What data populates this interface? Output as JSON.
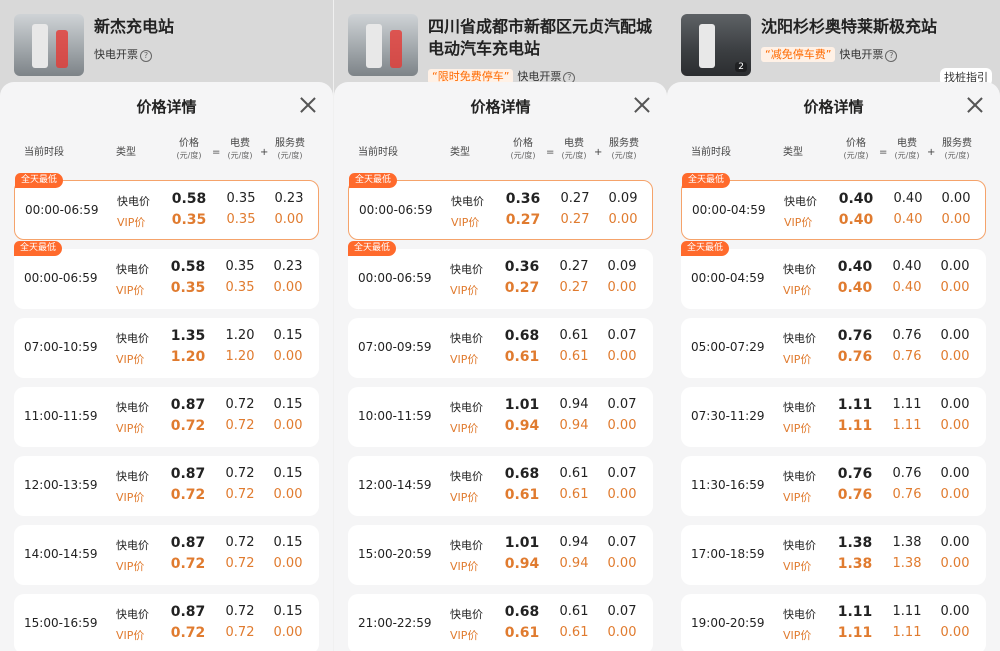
{
  "panels": [
    {
      "station_name": "新杰充电站",
      "promo_tag": "",
      "invoice": "快电开票",
      "guide": "",
      "photo_count": "",
      "title": "价格详情",
      "headers": {
        "time": "当前时段",
        "type": "类型",
        "price": "价格",
        "elec": "电费",
        "svc": "服务费",
        "unit": "(元/度)",
        "eq": "=",
        "plus": "+"
      },
      "rows": [
        {
          "badge": "全天最低",
          "time": "00:00-06:59",
          "fast": "快电价",
          "vip": "VIP价",
          "p": "0.58",
          "vp": "0.35",
          "e": "0.35",
          "ve": "0.35",
          "s": "0.23",
          "vs": "0.00"
        },
        {
          "badge": "全天最低",
          "time": "00:00-06:59",
          "fast": "快电价",
          "vip": "VIP价",
          "p": "0.58",
          "vp": "0.35",
          "e": "0.35",
          "ve": "0.35",
          "s": "0.23",
          "vs": "0.00"
        },
        {
          "badge": "",
          "time": "07:00-10:59",
          "fast": "快电价",
          "vip": "VIP价",
          "p": "1.35",
          "vp": "1.20",
          "e": "1.20",
          "ve": "1.20",
          "s": "0.15",
          "vs": "0.00"
        },
        {
          "badge": "",
          "time": "11:00-11:59",
          "fast": "快电价",
          "vip": "VIP价",
          "p": "0.87",
          "vp": "0.72",
          "e": "0.72",
          "ve": "0.72",
          "s": "0.15",
          "vs": "0.00"
        },
        {
          "badge": "",
          "time": "12:00-13:59",
          "fast": "快电价",
          "vip": "VIP价",
          "p": "0.87",
          "vp": "0.72",
          "e": "0.72",
          "ve": "0.72",
          "s": "0.15",
          "vs": "0.00"
        },
        {
          "badge": "",
          "time": "14:00-14:59",
          "fast": "快电价",
          "vip": "VIP价",
          "p": "0.87",
          "vp": "0.72",
          "e": "0.72",
          "ve": "0.72",
          "s": "0.15",
          "vs": "0.00"
        },
        {
          "badge": "",
          "time": "15:00-16:59",
          "fast": "快电价",
          "vip": "VIP价",
          "p": "0.87",
          "vp": "0.72",
          "e": "0.72",
          "ve": "0.72",
          "s": "0.15",
          "vs": "0.00"
        }
      ]
    },
    {
      "station_name": "四川省成都市新都区元贞汽配城电动汽车充电站",
      "promo_tag": "“限时免费停车”",
      "invoice": "快电开票",
      "guide": "",
      "photo_count": "",
      "title": "价格详情",
      "headers": {
        "time": "当前时段",
        "type": "类型",
        "price": "价格",
        "elec": "电费",
        "svc": "服务费",
        "unit": "(元/度)",
        "eq": "=",
        "plus": "+"
      },
      "rows": [
        {
          "badge": "全天最低",
          "time": "00:00-06:59",
          "fast": "快电价",
          "vip": "VIP价",
          "p": "0.36",
          "vp": "0.27",
          "e": "0.27",
          "ve": "0.27",
          "s": "0.09",
          "vs": "0.00"
        },
        {
          "badge": "全天最低",
          "time": "00:00-06:59",
          "fast": "快电价",
          "vip": "VIP价",
          "p": "0.36",
          "vp": "0.27",
          "e": "0.27",
          "ve": "0.27",
          "s": "0.09",
          "vs": "0.00"
        },
        {
          "badge": "",
          "time": "07:00-09:59",
          "fast": "快电价",
          "vip": "VIP价",
          "p": "0.68",
          "vp": "0.61",
          "e": "0.61",
          "ve": "0.61",
          "s": "0.07",
          "vs": "0.00"
        },
        {
          "badge": "",
          "time": "10:00-11:59",
          "fast": "快电价",
          "vip": "VIP价",
          "p": "1.01",
          "vp": "0.94",
          "e": "0.94",
          "ve": "0.94",
          "s": "0.07",
          "vs": "0.00"
        },
        {
          "badge": "",
          "time": "12:00-14:59",
          "fast": "快电价",
          "vip": "VIP价",
          "p": "0.68",
          "vp": "0.61",
          "e": "0.61",
          "ve": "0.61",
          "s": "0.07",
          "vs": "0.00"
        },
        {
          "badge": "",
          "time": "15:00-20:59",
          "fast": "快电价",
          "vip": "VIP价",
          "p": "1.01",
          "vp": "0.94",
          "e": "0.94",
          "ve": "0.94",
          "s": "0.07",
          "vs": "0.00"
        },
        {
          "badge": "",
          "time": "21:00-22:59",
          "fast": "快电价",
          "vip": "VIP价",
          "p": "0.68",
          "vp": "0.61",
          "e": "0.61",
          "ve": "0.61",
          "s": "0.07",
          "vs": "0.00"
        }
      ]
    },
    {
      "station_name": "沈阳杉杉奥特莱斯极充站",
      "promo_tag": "“减免停车费”",
      "invoice": "快电开票",
      "guide": "找桩指引",
      "photo_count": "2",
      "title": "价格详情",
      "headers": {
        "time": "当前时段",
        "type": "类型",
        "price": "价格",
        "elec": "电费",
        "svc": "服务费",
        "unit": "(元/度)",
        "eq": "=",
        "plus": "+"
      },
      "rows": [
        {
          "badge": "全天最低",
          "time": "00:00-04:59",
          "fast": "快电价",
          "vip": "VIP价",
          "p": "0.40",
          "vp": "0.40",
          "e": "0.40",
          "ve": "0.40",
          "s": "0.00",
          "vs": "0.00"
        },
        {
          "badge": "全天最低",
          "time": "00:00-04:59",
          "fast": "快电价",
          "vip": "VIP价",
          "p": "0.40",
          "vp": "0.40",
          "e": "0.40",
          "ve": "0.40",
          "s": "0.00",
          "vs": "0.00"
        },
        {
          "badge": "",
          "time": "05:00-07:29",
          "fast": "快电价",
          "vip": "VIP价",
          "p": "0.76",
          "vp": "0.76",
          "e": "0.76",
          "ve": "0.76",
          "s": "0.00",
          "vs": "0.00"
        },
        {
          "badge": "",
          "time": "07:30-11:29",
          "fast": "快电价",
          "vip": "VIP价",
          "p": "1.11",
          "vp": "1.11",
          "e": "1.11",
          "ve": "1.11",
          "s": "0.00",
          "vs": "0.00"
        },
        {
          "badge": "",
          "time": "11:30-16:59",
          "fast": "快电价",
          "vip": "VIP价",
          "p": "0.76",
          "vp": "0.76",
          "e": "0.76",
          "ve": "0.76",
          "s": "0.00",
          "vs": "0.00"
        },
        {
          "badge": "",
          "time": "17:00-18:59",
          "fast": "快电价",
          "vip": "VIP价",
          "p": "1.38",
          "vp": "1.38",
          "e": "1.38",
          "ve": "1.38",
          "s": "0.00",
          "vs": "0.00"
        },
        {
          "badge": "",
          "time": "19:00-20:59",
          "fast": "快电价",
          "vip": "VIP价",
          "p": "1.11",
          "vp": "1.11",
          "e": "1.11",
          "ve": "1.11",
          "s": "0.00",
          "vs": "0.00"
        }
      ]
    }
  ]
}
